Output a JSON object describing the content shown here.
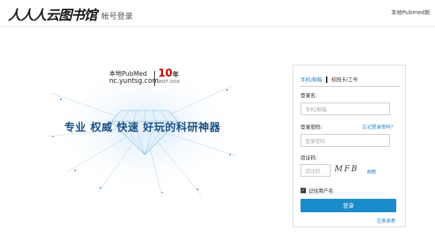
{
  "header": {
    "logo_text": "人人人云图书馆",
    "page_title": "帐号登录",
    "top_right_link": "本地Pubmed新"
  },
  "banner": {
    "brand_name": "本地PubMed",
    "brand_url": "nc.yuntsg.com",
    "anniversary_number": "10",
    "anniversary_suffix": "年",
    "anniversary_period": "2007-2016",
    "slogan": "专业 权威 快速 好玩的科研神器"
  },
  "login_panel": {
    "tab_phone_email": "手机/邮箱",
    "tab_campus_card": "校园卡/工号",
    "username_label": "登录名:",
    "username_placeholder": "手机/邮箱",
    "password_label": "登录密码:",
    "forgot_password": "忘记登录密码？",
    "password_placeholder": "登录密码",
    "captcha_label": "验证码:",
    "captcha_placeholder": "验证码",
    "captcha_text": "MFB",
    "refresh_label": "刷新",
    "remember_label": "记住用户名",
    "remember_checked": true,
    "login_button": "登录",
    "register_link": "注册读者"
  },
  "colors": {
    "accent": "#1c7fc4",
    "button": "#1a8ccc",
    "slogan": "#1a4f86",
    "highlight": "#cc0000"
  }
}
